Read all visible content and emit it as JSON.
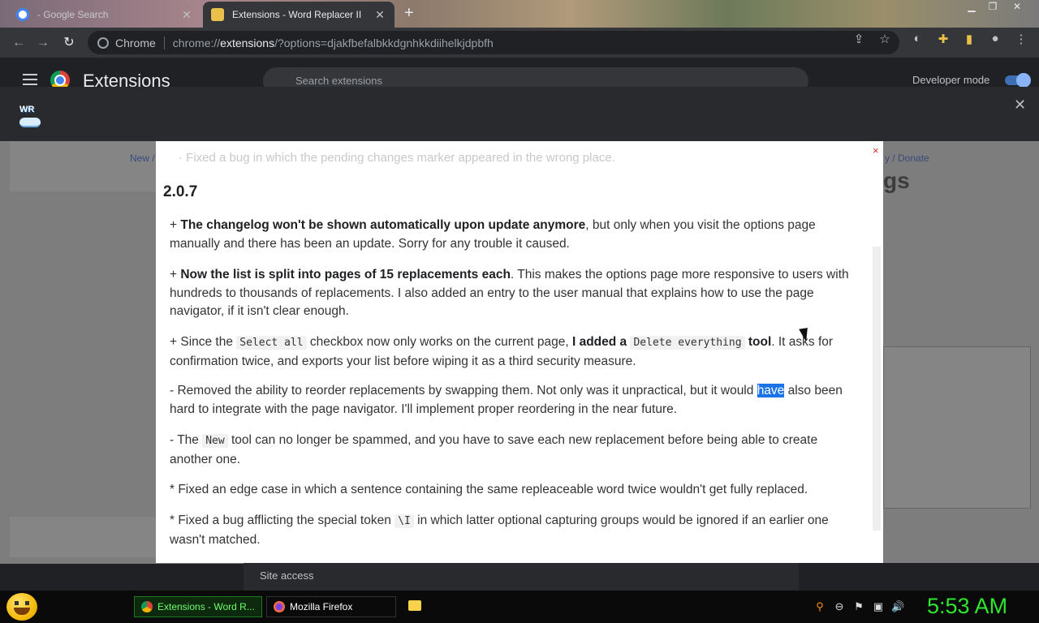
{
  "tabs": [
    {
      "label": "- Google Search",
      "active": false
    },
    {
      "label": "Extensions - Word Replacer II",
      "active": true
    }
  ],
  "omnibox": {
    "chip": "Chrome",
    "url_prefix": "chrome://",
    "url_host": "extensions",
    "url_rest": "/?options=djakfbefalbkkdgnhkkdiihelkjdpbfh"
  },
  "extensions_page": {
    "title": "Extensions",
    "search_placeholder": "Search extensions",
    "developer_mode_label": "Developer mode",
    "developer_mode_on": true,
    "site_access_label": "Site access"
  },
  "options_overlay": {
    "logo_text": "WR",
    "bg_left_link": "New /",
    "bg_right_link": "y / Donate",
    "bg_title_fragment": "gs",
    "close_glyph": "✕"
  },
  "changelog": {
    "faded_line": "· Fixed a bug in which the pending changes marker appeared in the wrong place.",
    "version": "2.0.7",
    "close_glyph": "×",
    "p1": {
      "prefix": "+ ",
      "bold": "The changelog won't be shown automatically upon update anymore",
      "rest": ", but only when you visit the options page manually and there has been an update. Sorry for any trouble it caused."
    },
    "p2": {
      "prefix": "+ ",
      "bold": "Now the list is split into pages of 15 replacements each",
      "rest": ". This makes the options page more responsive to users with hundreds to thousands of replacements. I also added an entry to the user manual that explains how to use the page navigator, if it isn't clear enough."
    },
    "p3": {
      "a": "+ Since the ",
      "code1": "Select all",
      "b": " checkbox now only works on the current page, ",
      "bold1": "I added a",
      "code2": "Delete everything",
      "bold2": "tool",
      "c": ". It asks for confirmation twice, and exports your list before wiping it as a third security measure."
    },
    "p4": {
      "a": "- Removed the ability to reorder replacements by swapping them. Not only was it unpractical, but it would ",
      "highlight": "have",
      "b": " also been hard to integrate with the page navigator. I'll implement proper reordering in the near future."
    },
    "p5": {
      "a": "- The ",
      "code": "New",
      "b": " tool can no longer be spammed, and you have to save each new replacement before being able to create another one."
    },
    "p6": "* Fixed an edge case in which a sentence containing the same repleaceable word twice wouldn't get fully replaced.",
    "p7": {
      "a": "* Fixed a bug afflicting the special token ",
      "code": "\\I",
      "b": " in which latter optional capturing groups would be ignored if an earlier one wasn't matched."
    }
  },
  "taskbar": {
    "task1": "Extensions - Word R...",
    "task2": "Mozilla Firefox",
    "clock": "5:53 AM"
  },
  "colors": {
    "accent": "#1a73e8",
    "clock": "#2ee62e",
    "modal_close": "#d93025"
  }
}
